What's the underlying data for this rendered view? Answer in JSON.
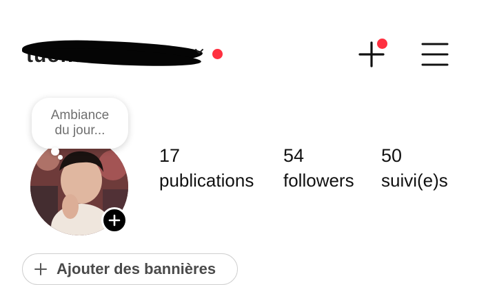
{
  "header": {
    "username": "tuonal744",
    "username_redacted": true,
    "notification_dot_color": "#ff3040",
    "create_icon": "plus-icon",
    "menu_icon": "hamburger-menu-icon"
  },
  "note": {
    "line1": "Ambiance",
    "line2": "du jour..."
  },
  "profile": {
    "avatar_icon": "profile-photo",
    "add_story_icon": "plus-icon"
  },
  "stats": [
    {
      "value": "17",
      "label": "publications"
    },
    {
      "value": "54",
      "label": "followers"
    },
    {
      "value": "50",
      "label": "suivi(e)s"
    }
  ],
  "banner_button": {
    "label": "Ajouter des bannières",
    "icon": "plus-icon"
  }
}
